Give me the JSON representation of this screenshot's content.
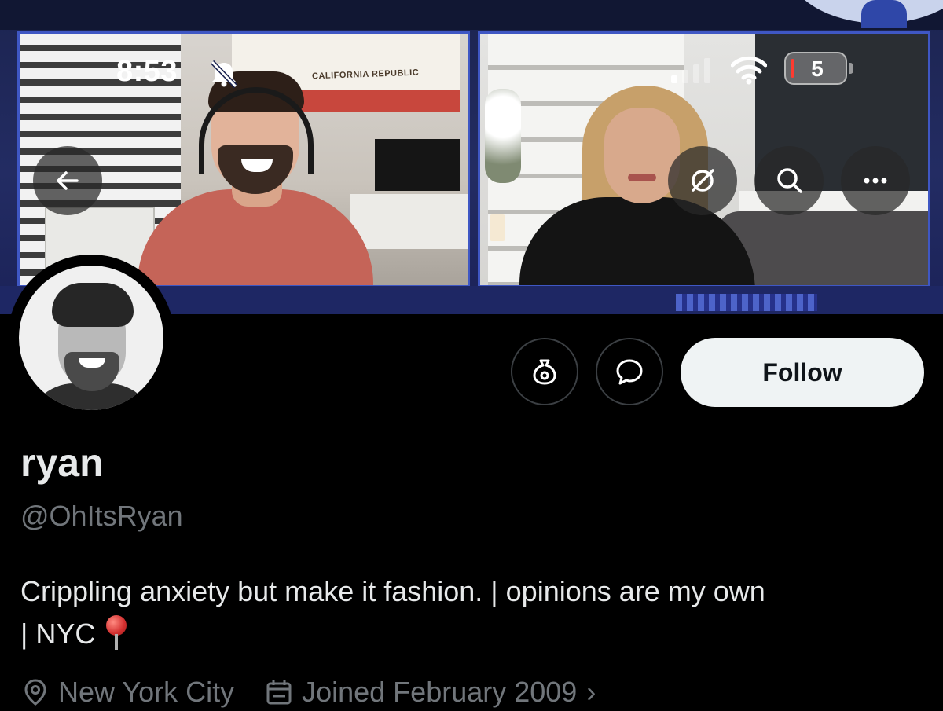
{
  "status_bar": {
    "time": "8:53",
    "battery_percent": "5",
    "battery_level": 0.05
  },
  "banner": {
    "flag_text": "CALIFORNIA REPUBLIC"
  },
  "header_buttons": {
    "back_icon": "arrow-left-icon",
    "translate_icon": "no-translate-icon",
    "search_icon": "search-icon",
    "more_icon": "more-icon"
  },
  "actions": {
    "grok_icon": "grok-icon",
    "message_icon": "message-icon",
    "follow_label": "Follow"
  },
  "profile": {
    "display_name": "ryan",
    "handle": "@OhItsRyan",
    "bio_line1": "Crippling anxiety but make it fashion. | opinions are my own",
    "bio_line2": "| NYC",
    "bio_emoji": "round-pushpin-icon",
    "location": "New York City",
    "joined": "Joined February 2009"
  },
  "colors": {
    "background": "#000000",
    "text_primary": "#e7e9ea",
    "text_secondary": "#71767b",
    "follow_bg": "#eff3f4",
    "banner_frame": "#3f57c4",
    "battery_low": "#ff3b30"
  }
}
